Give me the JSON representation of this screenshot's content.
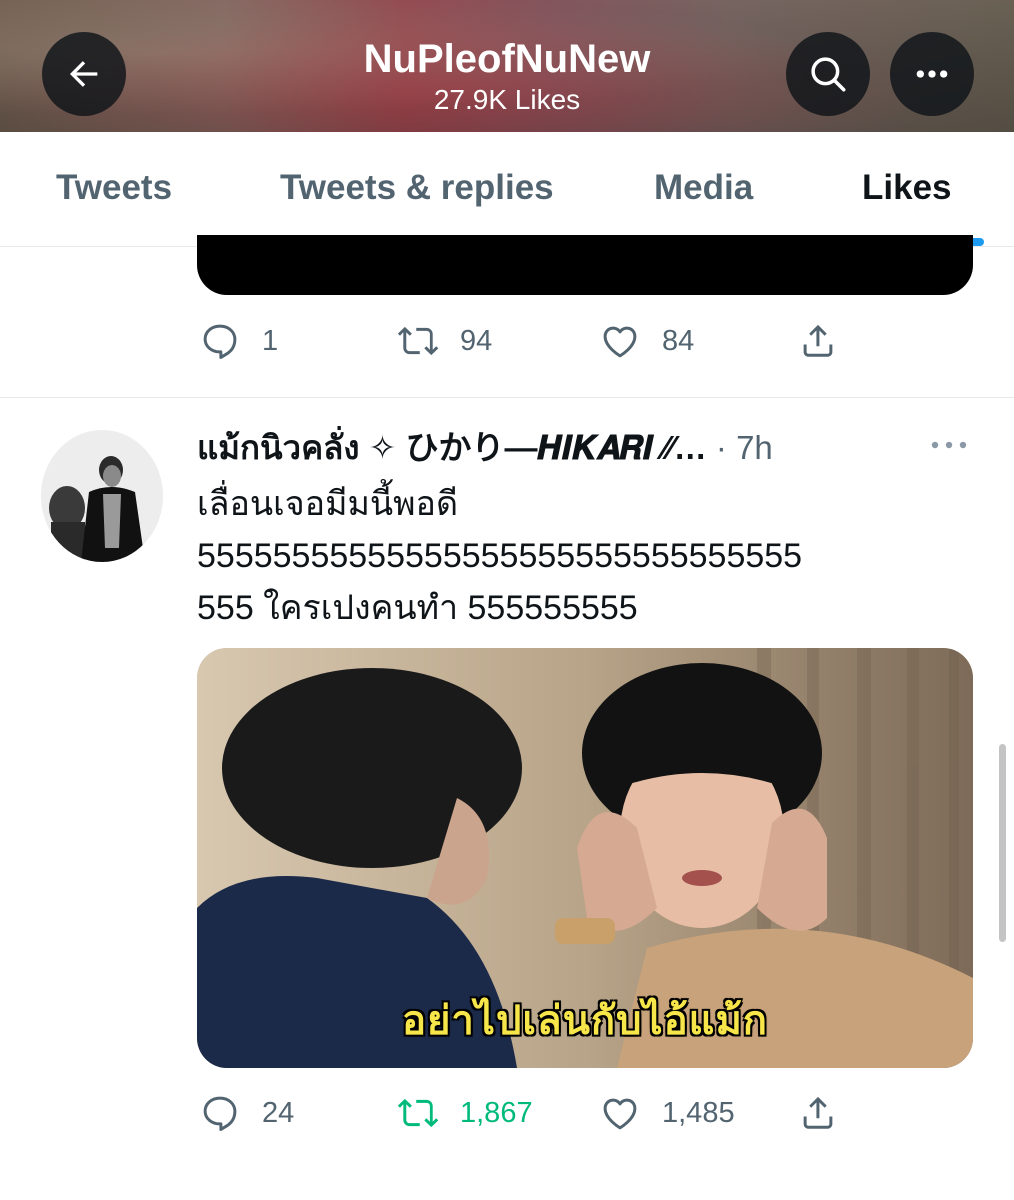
{
  "header": {
    "title": "NuPleofNuNew",
    "subtitle": "27.9K Likes"
  },
  "tabs": [
    {
      "label": "Tweets"
    },
    {
      "label": "Tweets & replies"
    },
    {
      "label": "Media"
    },
    {
      "label": "Likes",
      "active": true
    }
  ],
  "tweet1": {
    "replies": "1",
    "retweets": "94",
    "likes": "84"
  },
  "tweet2": {
    "author": "แม้กนิวคลั่ง ✧ ひかり—𝑯𝑰𝑲𝑨𝑹𝑰 ⁄⁄…",
    "separator": "·",
    "time": "7h",
    "text_lines": [
      "เลื่อนเจอมีมนี้พอดี",
      "55555555555555555555555555555555",
      "555 ใครเปงคนทำ 555555555"
    ],
    "media_caption": "อย่าไปเล่นกับไอ้แม้ก",
    "replies": "24",
    "retweets": "1,867",
    "likes": "1,485",
    "retweeted": true
  },
  "colors": {
    "accent": "#1d9bf0",
    "retweet_active": "#00ba7c",
    "secondary_text": "#536471"
  }
}
